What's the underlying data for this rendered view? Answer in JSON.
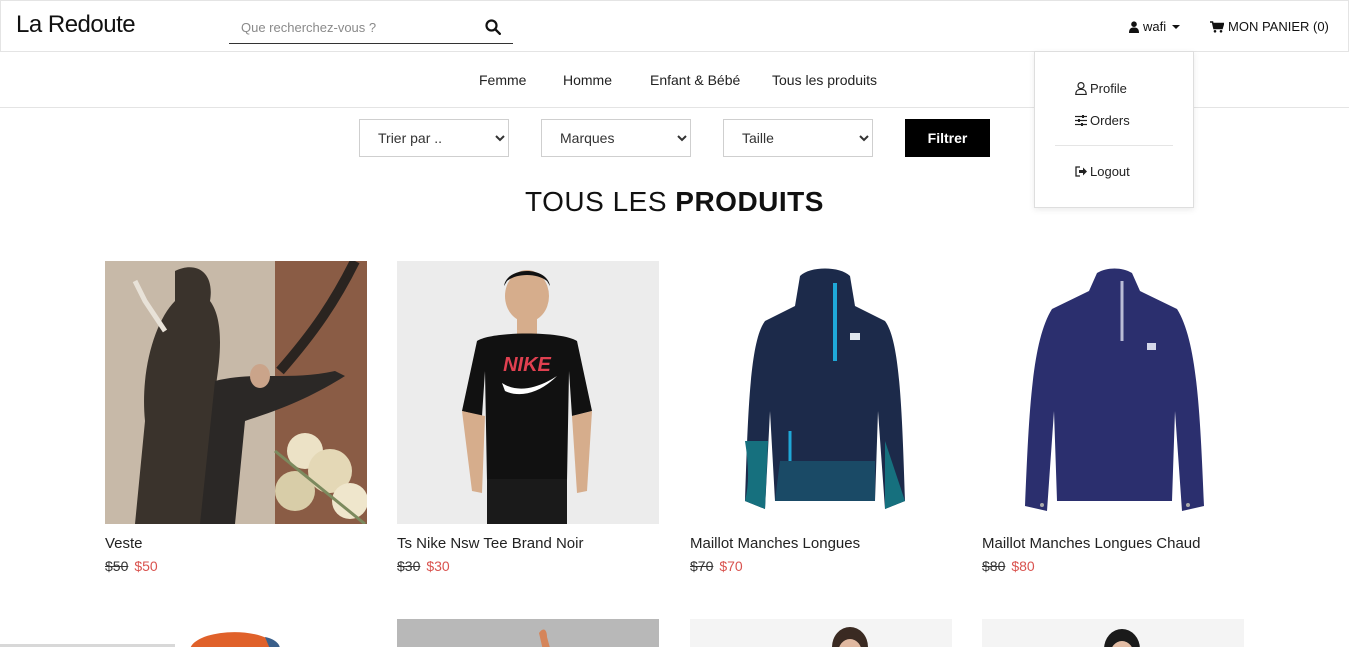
{
  "header": {
    "logo": "La Redoute",
    "search_placeholder": "Que recherchez-vous ?",
    "user_name": "wafi",
    "cart_label": "MON PANIER (0)"
  },
  "nav": {
    "items": [
      "Femme",
      "Homme",
      "Enfant & Bébé",
      "Tous les produits"
    ]
  },
  "filters": {
    "sort_label": "Trier par ..",
    "brands_label": "Marques",
    "size_label": "Taille",
    "submit_label": "Filtrer"
  },
  "section": {
    "title_light": "TOUS LES ",
    "title_bold": "PRODUITS"
  },
  "products": [
    {
      "name": "Veste",
      "old_price": "$50",
      "price": "$50"
    },
    {
      "name": "Ts Nike Nsw Tee Brand Noir",
      "old_price": "$30",
      "price": "$30"
    },
    {
      "name": "Maillot Manches Longues",
      "old_price": "$70",
      "price": "$70"
    },
    {
      "name": "Maillot Manches Longues Chaud",
      "old_price": "$80",
      "price": "$80"
    }
  ],
  "user_dropdown": {
    "items": [
      "Profile",
      "Orders",
      "Logout"
    ]
  },
  "colors": {
    "sale_price": "#d9534f",
    "button_bg": "#000000",
    "border": "#e4e4e4"
  }
}
